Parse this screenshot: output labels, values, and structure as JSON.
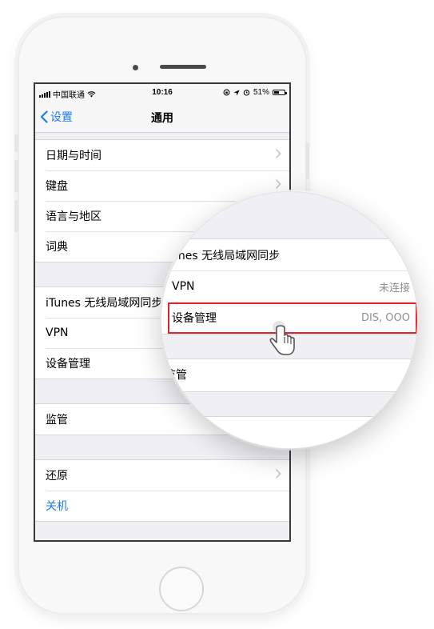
{
  "status_bar": {
    "carrier": "中国联通",
    "time": "10:16",
    "battery": "51%",
    "battery_level": 0.51
  },
  "nav": {
    "back_label": "设置",
    "title": "通用"
  },
  "groups": [
    {
      "items": [
        {
          "label": "日期与时间",
          "chevron": true
        },
        {
          "label": "键盘",
          "chevron": true
        },
        {
          "label": "语言与地区",
          "chevron": false
        },
        {
          "label": "词典",
          "chevron": false
        }
      ]
    },
    {
      "items": [
        {
          "label": "iTunes 无线局域网同步",
          "chevron": false
        },
        {
          "label": "VPN",
          "chevron": false
        },
        {
          "label": "设备管理",
          "chevron": false
        }
      ]
    },
    {
      "items": [
        {
          "label": "监管",
          "chevron": false
        }
      ]
    },
    {
      "items": [
        {
          "label": "还原",
          "chevron": true
        },
        {
          "label": "关机",
          "chevron": false,
          "accent": "#1a7cf5"
        }
      ]
    }
  ],
  "magnifier": {
    "itunes_label": "unes 无线局域网同步",
    "vpn_label": "VPN",
    "vpn_value": "未连接",
    "device_mgmt_label": "设备管理",
    "device_mgmt_value": "DIS, OOO",
    "supervision_label": "监管",
    "highlight_color": "#e0252b"
  },
  "colors": {
    "ios_blue": "#1a7cf5",
    "background": "#efeff4"
  }
}
